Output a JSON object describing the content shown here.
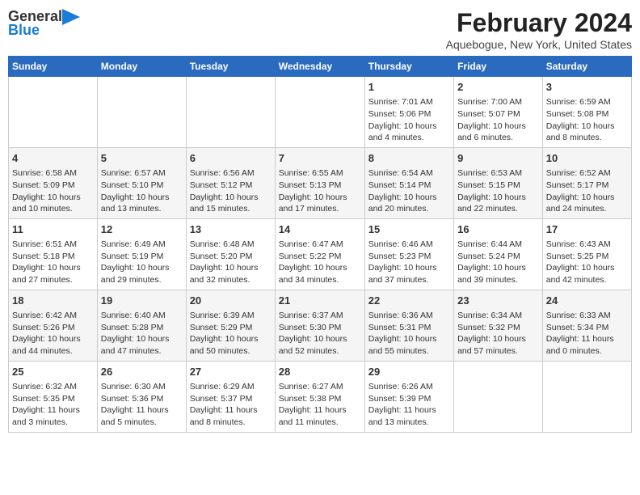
{
  "header": {
    "logo_general": "General",
    "logo_blue": "Blue",
    "title": "February 2024",
    "subtitle": "Aquebogue, New York, United States"
  },
  "days_of_week": [
    "Sunday",
    "Monday",
    "Tuesday",
    "Wednesday",
    "Thursday",
    "Friday",
    "Saturday"
  ],
  "weeks": [
    [
      {
        "day": "",
        "info": ""
      },
      {
        "day": "",
        "info": ""
      },
      {
        "day": "",
        "info": ""
      },
      {
        "day": "",
        "info": ""
      },
      {
        "day": "1",
        "info": "Sunrise: 7:01 AM\nSunset: 5:06 PM\nDaylight: 10 hours\nand 4 minutes."
      },
      {
        "day": "2",
        "info": "Sunrise: 7:00 AM\nSunset: 5:07 PM\nDaylight: 10 hours\nand 6 minutes."
      },
      {
        "day": "3",
        "info": "Sunrise: 6:59 AM\nSunset: 5:08 PM\nDaylight: 10 hours\nand 8 minutes."
      }
    ],
    [
      {
        "day": "4",
        "info": "Sunrise: 6:58 AM\nSunset: 5:09 PM\nDaylight: 10 hours\nand 10 minutes."
      },
      {
        "day": "5",
        "info": "Sunrise: 6:57 AM\nSunset: 5:10 PM\nDaylight: 10 hours\nand 13 minutes."
      },
      {
        "day": "6",
        "info": "Sunrise: 6:56 AM\nSunset: 5:12 PM\nDaylight: 10 hours\nand 15 minutes."
      },
      {
        "day": "7",
        "info": "Sunrise: 6:55 AM\nSunset: 5:13 PM\nDaylight: 10 hours\nand 17 minutes."
      },
      {
        "day": "8",
        "info": "Sunrise: 6:54 AM\nSunset: 5:14 PM\nDaylight: 10 hours\nand 20 minutes."
      },
      {
        "day": "9",
        "info": "Sunrise: 6:53 AM\nSunset: 5:15 PM\nDaylight: 10 hours\nand 22 minutes."
      },
      {
        "day": "10",
        "info": "Sunrise: 6:52 AM\nSunset: 5:17 PM\nDaylight: 10 hours\nand 24 minutes."
      }
    ],
    [
      {
        "day": "11",
        "info": "Sunrise: 6:51 AM\nSunset: 5:18 PM\nDaylight: 10 hours\nand 27 minutes."
      },
      {
        "day": "12",
        "info": "Sunrise: 6:49 AM\nSunset: 5:19 PM\nDaylight: 10 hours\nand 29 minutes."
      },
      {
        "day": "13",
        "info": "Sunrise: 6:48 AM\nSunset: 5:20 PM\nDaylight: 10 hours\nand 32 minutes."
      },
      {
        "day": "14",
        "info": "Sunrise: 6:47 AM\nSunset: 5:22 PM\nDaylight: 10 hours\nand 34 minutes."
      },
      {
        "day": "15",
        "info": "Sunrise: 6:46 AM\nSunset: 5:23 PM\nDaylight: 10 hours\nand 37 minutes."
      },
      {
        "day": "16",
        "info": "Sunrise: 6:44 AM\nSunset: 5:24 PM\nDaylight: 10 hours\nand 39 minutes."
      },
      {
        "day": "17",
        "info": "Sunrise: 6:43 AM\nSunset: 5:25 PM\nDaylight: 10 hours\nand 42 minutes."
      }
    ],
    [
      {
        "day": "18",
        "info": "Sunrise: 6:42 AM\nSunset: 5:26 PM\nDaylight: 10 hours\nand 44 minutes."
      },
      {
        "day": "19",
        "info": "Sunrise: 6:40 AM\nSunset: 5:28 PM\nDaylight: 10 hours\nand 47 minutes."
      },
      {
        "day": "20",
        "info": "Sunrise: 6:39 AM\nSunset: 5:29 PM\nDaylight: 10 hours\nand 50 minutes."
      },
      {
        "day": "21",
        "info": "Sunrise: 6:37 AM\nSunset: 5:30 PM\nDaylight: 10 hours\nand 52 minutes."
      },
      {
        "day": "22",
        "info": "Sunrise: 6:36 AM\nSunset: 5:31 PM\nDaylight: 10 hours\nand 55 minutes."
      },
      {
        "day": "23",
        "info": "Sunrise: 6:34 AM\nSunset: 5:32 PM\nDaylight: 10 hours\nand 57 minutes."
      },
      {
        "day": "24",
        "info": "Sunrise: 6:33 AM\nSunset: 5:34 PM\nDaylight: 11 hours\nand 0 minutes."
      }
    ],
    [
      {
        "day": "25",
        "info": "Sunrise: 6:32 AM\nSunset: 5:35 PM\nDaylight: 11 hours\nand 3 minutes."
      },
      {
        "day": "26",
        "info": "Sunrise: 6:30 AM\nSunset: 5:36 PM\nDaylight: 11 hours\nand 5 minutes."
      },
      {
        "day": "27",
        "info": "Sunrise: 6:29 AM\nSunset: 5:37 PM\nDaylight: 11 hours\nand 8 minutes."
      },
      {
        "day": "28",
        "info": "Sunrise: 6:27 AM\nSunset: 5:38 PM\nDaylight: 11 hours\nand 11 minutes."
      },
      {
        "day": "29",
        "info": "Sunrise: 6:26 AM\nSunset: 5:39 PM\nDaylight: 11 hours\nand 13 minutes."
      },
      {
        "day": "",
        "info": ""
      },
      {
        "day": "",
        "info": ""
      }
    ]
  ]
}
